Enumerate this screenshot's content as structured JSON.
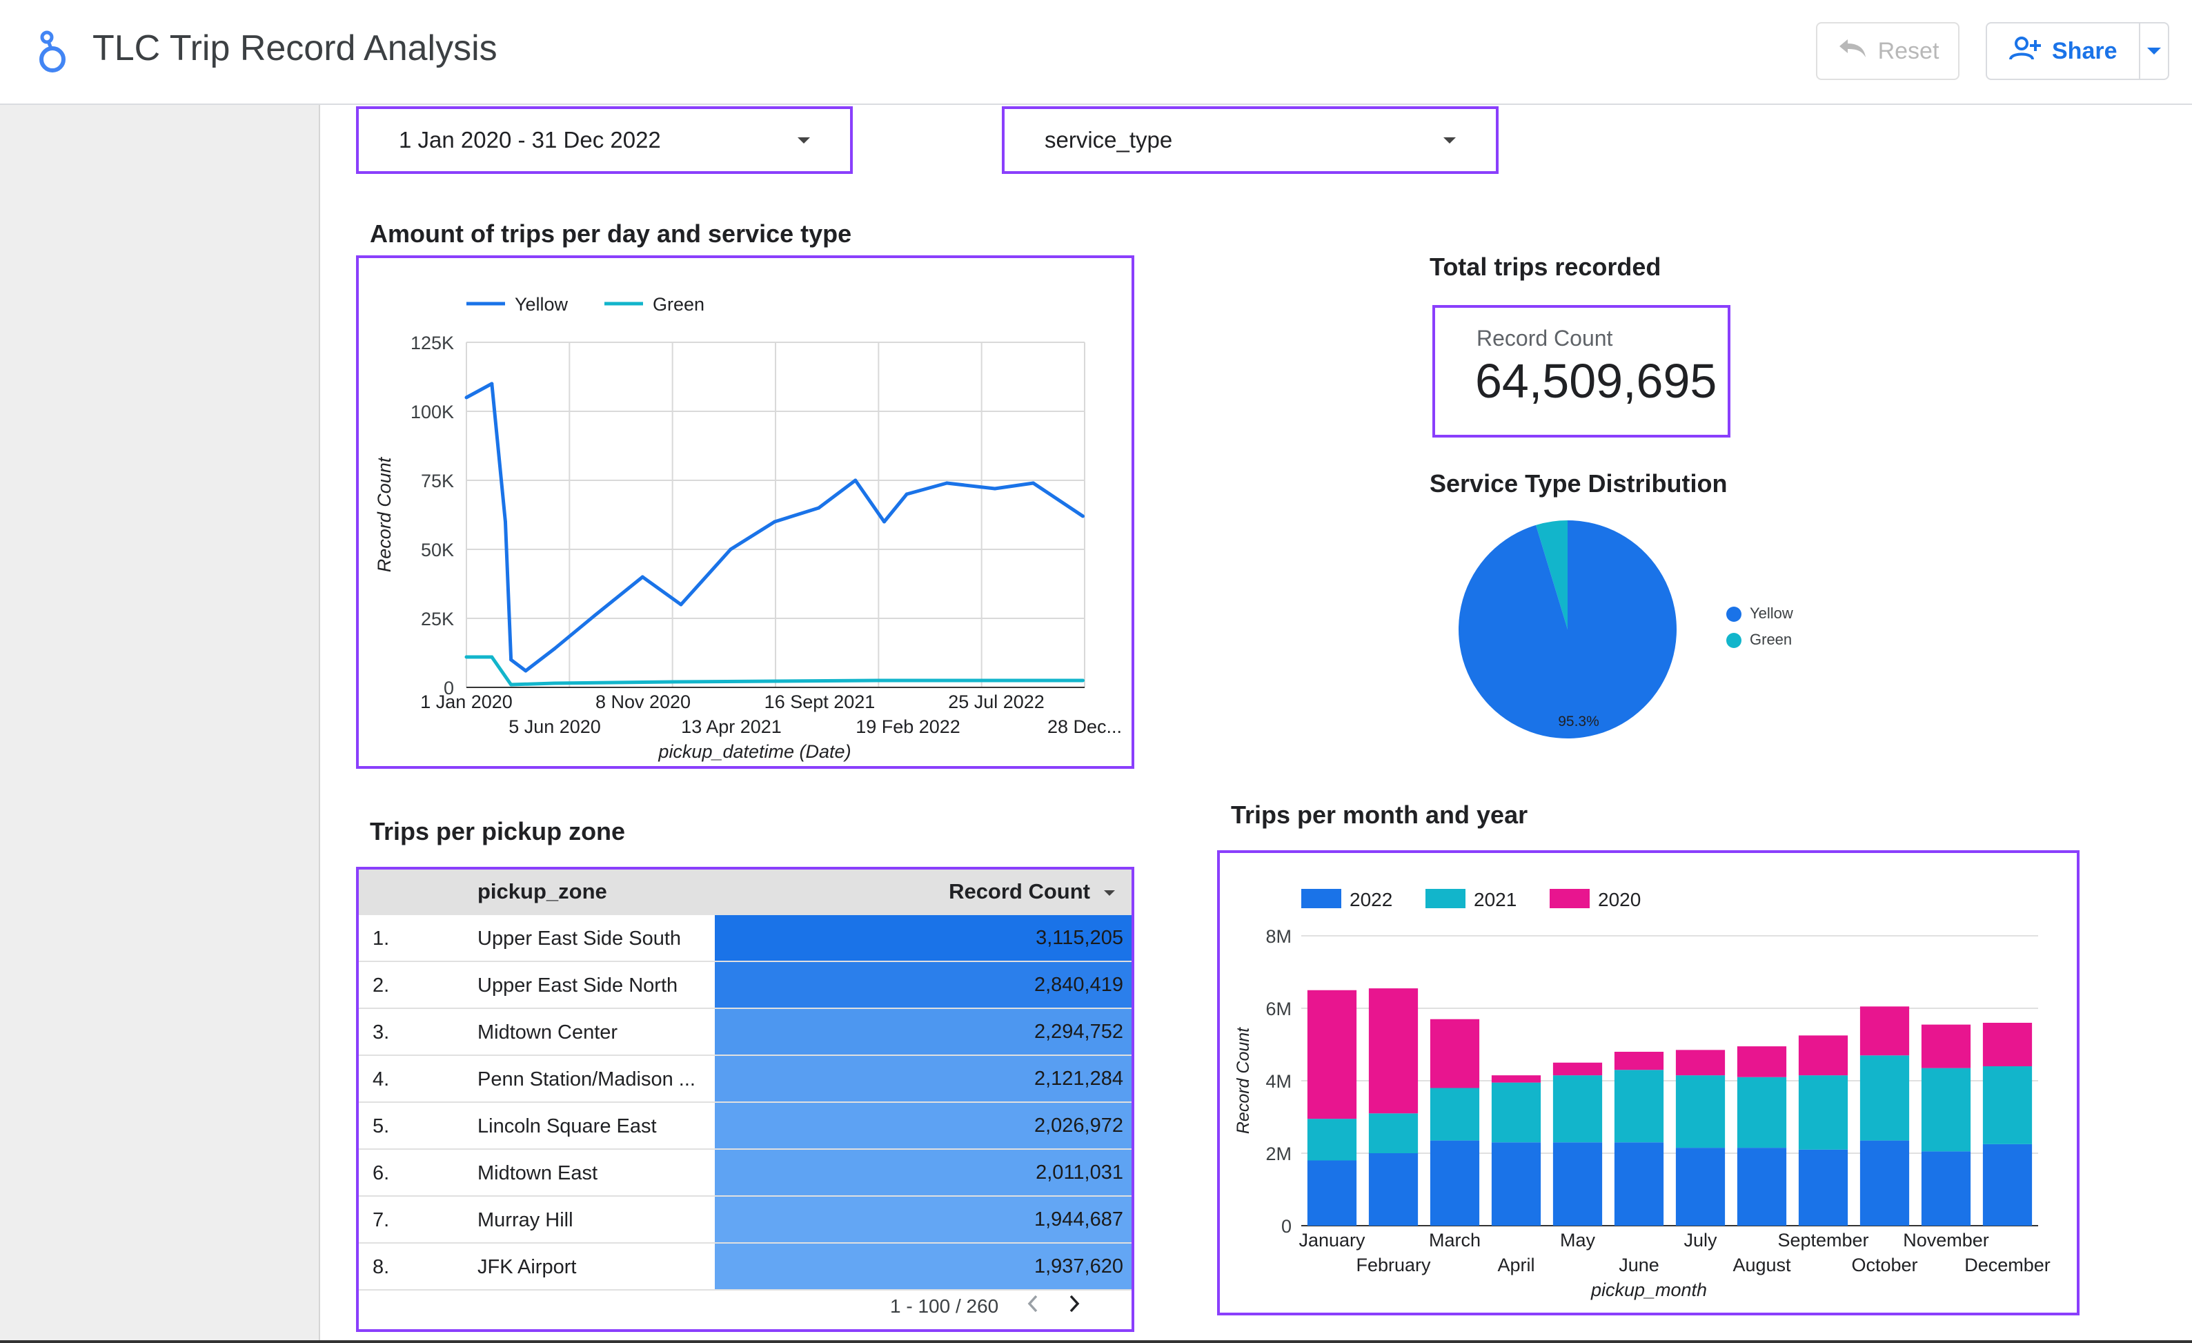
{
  "header": {
    "title": "TLC Trip Record Analysis",
    "reset_label": "Reset",
    "share_label": "Share"
  },
  "filters": {
    "date_range": "1 Jan 2020 - 31 Dec 2022",
    "dimension": "service_type"
  },
  "colors": {
    "accent_purple": "#8a3ffc",
    "yellow_series": "#1a73e8",
    "green_series": "#12b5cb",
    "year_2022": "#1a73e8",
    "year_2021": "#12b5cb",
    "year_2020": "#e8158f"
  },
  "line_section": {
    "title": "Amount of trips per day and service type"
  },
  "scorecard_section": {
    "title": "Total trips recorded",
    "label": "Record Count",
    "value": "64,509,695"
  },
  "pie_section": {
    "title": "Service Type Distribution"
  },
  "table_section": {
    "title": "Trips per pickup zone",
    "col_zone": "pickup_zone",
    "col_count": "Record Count",
    "rows": [
      {
        "rank": "1.",
        "zone": "Upper East Side South",
        "count": "3,115,205",
        "value": 3115205
      },
      {
        "rank": "2.",
        "zone": "Upper East Side North",
        "count": "2,840,419",
        "value": 2840419
      },
      {
        "rank": "3.",
        "zone": "Midtown Center",
        "count": "2,294,752",
        "value": 2294752
      },
      {
        "rank": "4.",
        "zone": "Penn Station/Madison ...",
        "count": "2,121,284",
        "value": 2121284
      },
      {
        "rank": "5.",
        "zone": "Lincoln Square East",
        "count": "2,026,972",
        "value": 2026972
      },
      {
        "rank": "6.",
        "zone": "Midtown East",
        "count": "2,011,031",
        "value": 2011031
      },
      {
        "rank": "7.",
        "zone": "Murray Hill",
        "count": "1,944,687",
        "value": 1944687
      },
      {
        "rank": "8.",
        "zone": "JFK Airport",
        "count": "1,937,620",
        "value": 1937620
      }
    ],
    "pagination": "1 - 100 / 260"
  },
  "bar_section": {
    "title": "Trips per month and year"
  },
  "chart_data": [
    {
      "type": "line",
      "ylabel": "Record Count",
      "xlabel": "pickup_datetime (Date)",
      "legend": "top",
      "ylim": [
        0,
        125000
      ],
      "yticks": [
        "0",
        "25K",
        "50K",
        "75K",
        "100K",
        "125K"
      ],
      "xticks": [
        "1 Jan 2020",
        "5 Jun 2020",
        "8 Nov 2020",
        "13 Apr 2021",
        "16 Sept 2021",
        "19 Feb 2022",
        "25 Jul 2022",
        "28 Dec..."
      ],
      "grid": true,
      "series": [
        {
          "name": "Yellow",
          "x": [
            "2020-01-01",
            "2020-02-15",
            "2020-03-10",
            "2020-03-20",
            "2020-04-15",
            "2020-06-05",
            "2020-08-15",
            "2020-11-08",
            "2021-01-15",
            "2021-04-13",
            "2021-06-30",
            "2021-09-16",
            "2021-11-20",
            "2022-01-10",
            "2022-02-19",
            "2022-05-01",
            "2022-07-25",
            "2022-10-01",
            "2022-12-28"
          ],
          "values": [
            105000,
            110000,
            60000,
            10000,
            6000,
            14000,
            26000,
            40000,
            30000,
            50000,
            60000,
            65000,
            75000,
            60000,
            70000,
            74000,
            72000,
            74000,
            62000
          ]
        },
        {
          "name": "Green",
          "x": [
            "2020-01-01",
            "2020-02-15",
            "2020-03-20",
            "2020-06-05",
            "2021-01-01",
            "2022-01-01",
            "2022-12-28"
          ],
          "values": [
            11000,
            11000,
            1000,
            1500,
            2000,
            2500,
            2500
          ]
        }
      ]
    },
    {
      "type": "pie",
      "legend": "right",
      "series": [
        {
          "name": "Yellow",
          "values": [
            95.3
          ]
        },
        {
          "name": "Green",
          "values": [
            4.7
          ]
        }
      ],
      "data_labels": [
        "95.3%"
      ]
    },
    {
      "type": "bar",
      "stacked": true,
      "ylabel": "Record Count",
      "xlabel": "pickup_month",
      "legend": "top",
      "ylim": [
        0,
        8000000
      ],
      "yticks": [
        "0",
        "2M",
        "4M",
        "6M",
        "8M"
      ],
      "categories": [
        "January",
        "February",
        "March",
        "April",
        "May",
        "June",
        "July",
        "August",
        "September",
        "October",
        "November",
        "December"
      ],
      "series": [
        {
          "name": "2022",
          "values": [
            1800000,
            2000000,
            2350000,
            2300000,
            2300000,
            2300000,
            2150000,
            2150000,
            2100000,
            2350000,
            2050000,
            2250000
          ]
        },
        {
          "name": "2021",
          "values": [
            1150000,
            1100000,
            1450000,
            1650000,
            1850000,
            2000000,
            2000000,
            1950000,
            2050000,
            2350000,
            2300000,
            2150000
          ]
        },
        {
          "name": "2020",
          "values": [
            3550000,
            3450000,
            1900000,
            200000,
            350000,
            500000,
            700000,
            850000,
            1100000,
            1350000,
            1200000,
            1200000
          ]
        }
      ]
    }
  ]
}
